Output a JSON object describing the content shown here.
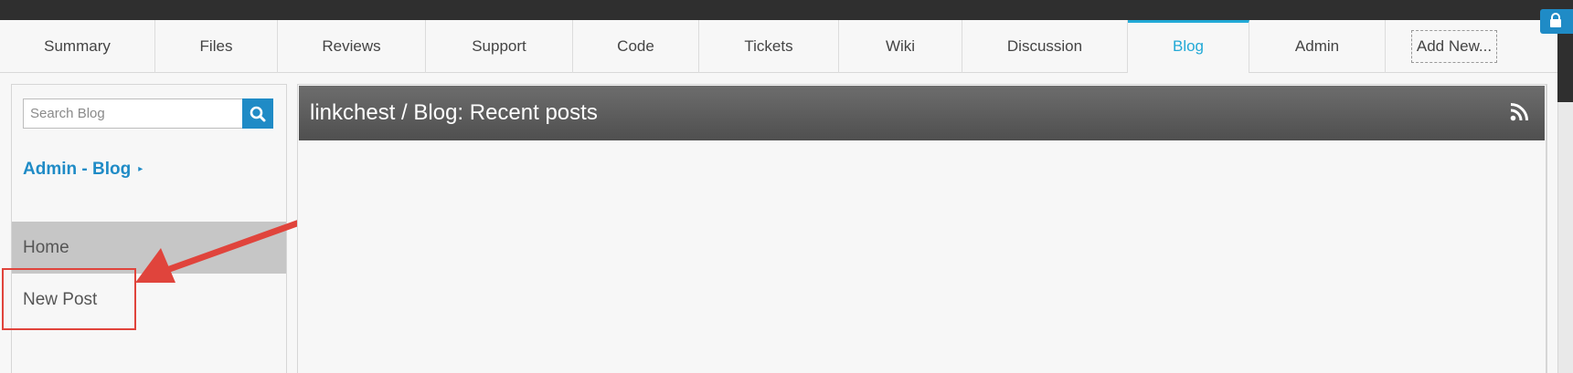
{
  "tabs": [
    {
      "label": "Summary",
      "active": false
    },
    {
      "label": "Files",
      "active": false
    },
    {
      "label": "Reviews",
      "active": false
    },
    {
      "label": "Support",
      "active": false
    },
    {
      "label": "Code",
      "active": false
    },
    {
      "label": "Tickets",
      "active": false
    },
    {
      "label": "Wiki",
      "active": false
    },
    {
      "label": "Discussion",
      "active": false
    },
    {
      "label": "Blog",
      "active": true
    },
    {
      "label": "Admin",
      "active": false
    }
  ],
  "add_new_label": "Add New...",
  "sidebar": {
    "search_placeholder": "Search Blog",
    "admin_link": "Admin - Blog",
    "admin_caret": "▸",
    "items": [
      {
        "label": "Home",
        "selected": true
      },
      {
        "label": "New Post",
        "selected": false
      }
    ]
  },
  "main": {
    "title": "linkchest / Blog: Recent posts"
  },
  "icons": {
    "search": "search-icon",
    "rss": "rss-icon",
    "lock": "lock-icon"
  },
  "colors": {
    "accent": "#1f8bc6",
    "active_tab": "#22a9d6",
    "annotation": "#e0443c"
  }
}
